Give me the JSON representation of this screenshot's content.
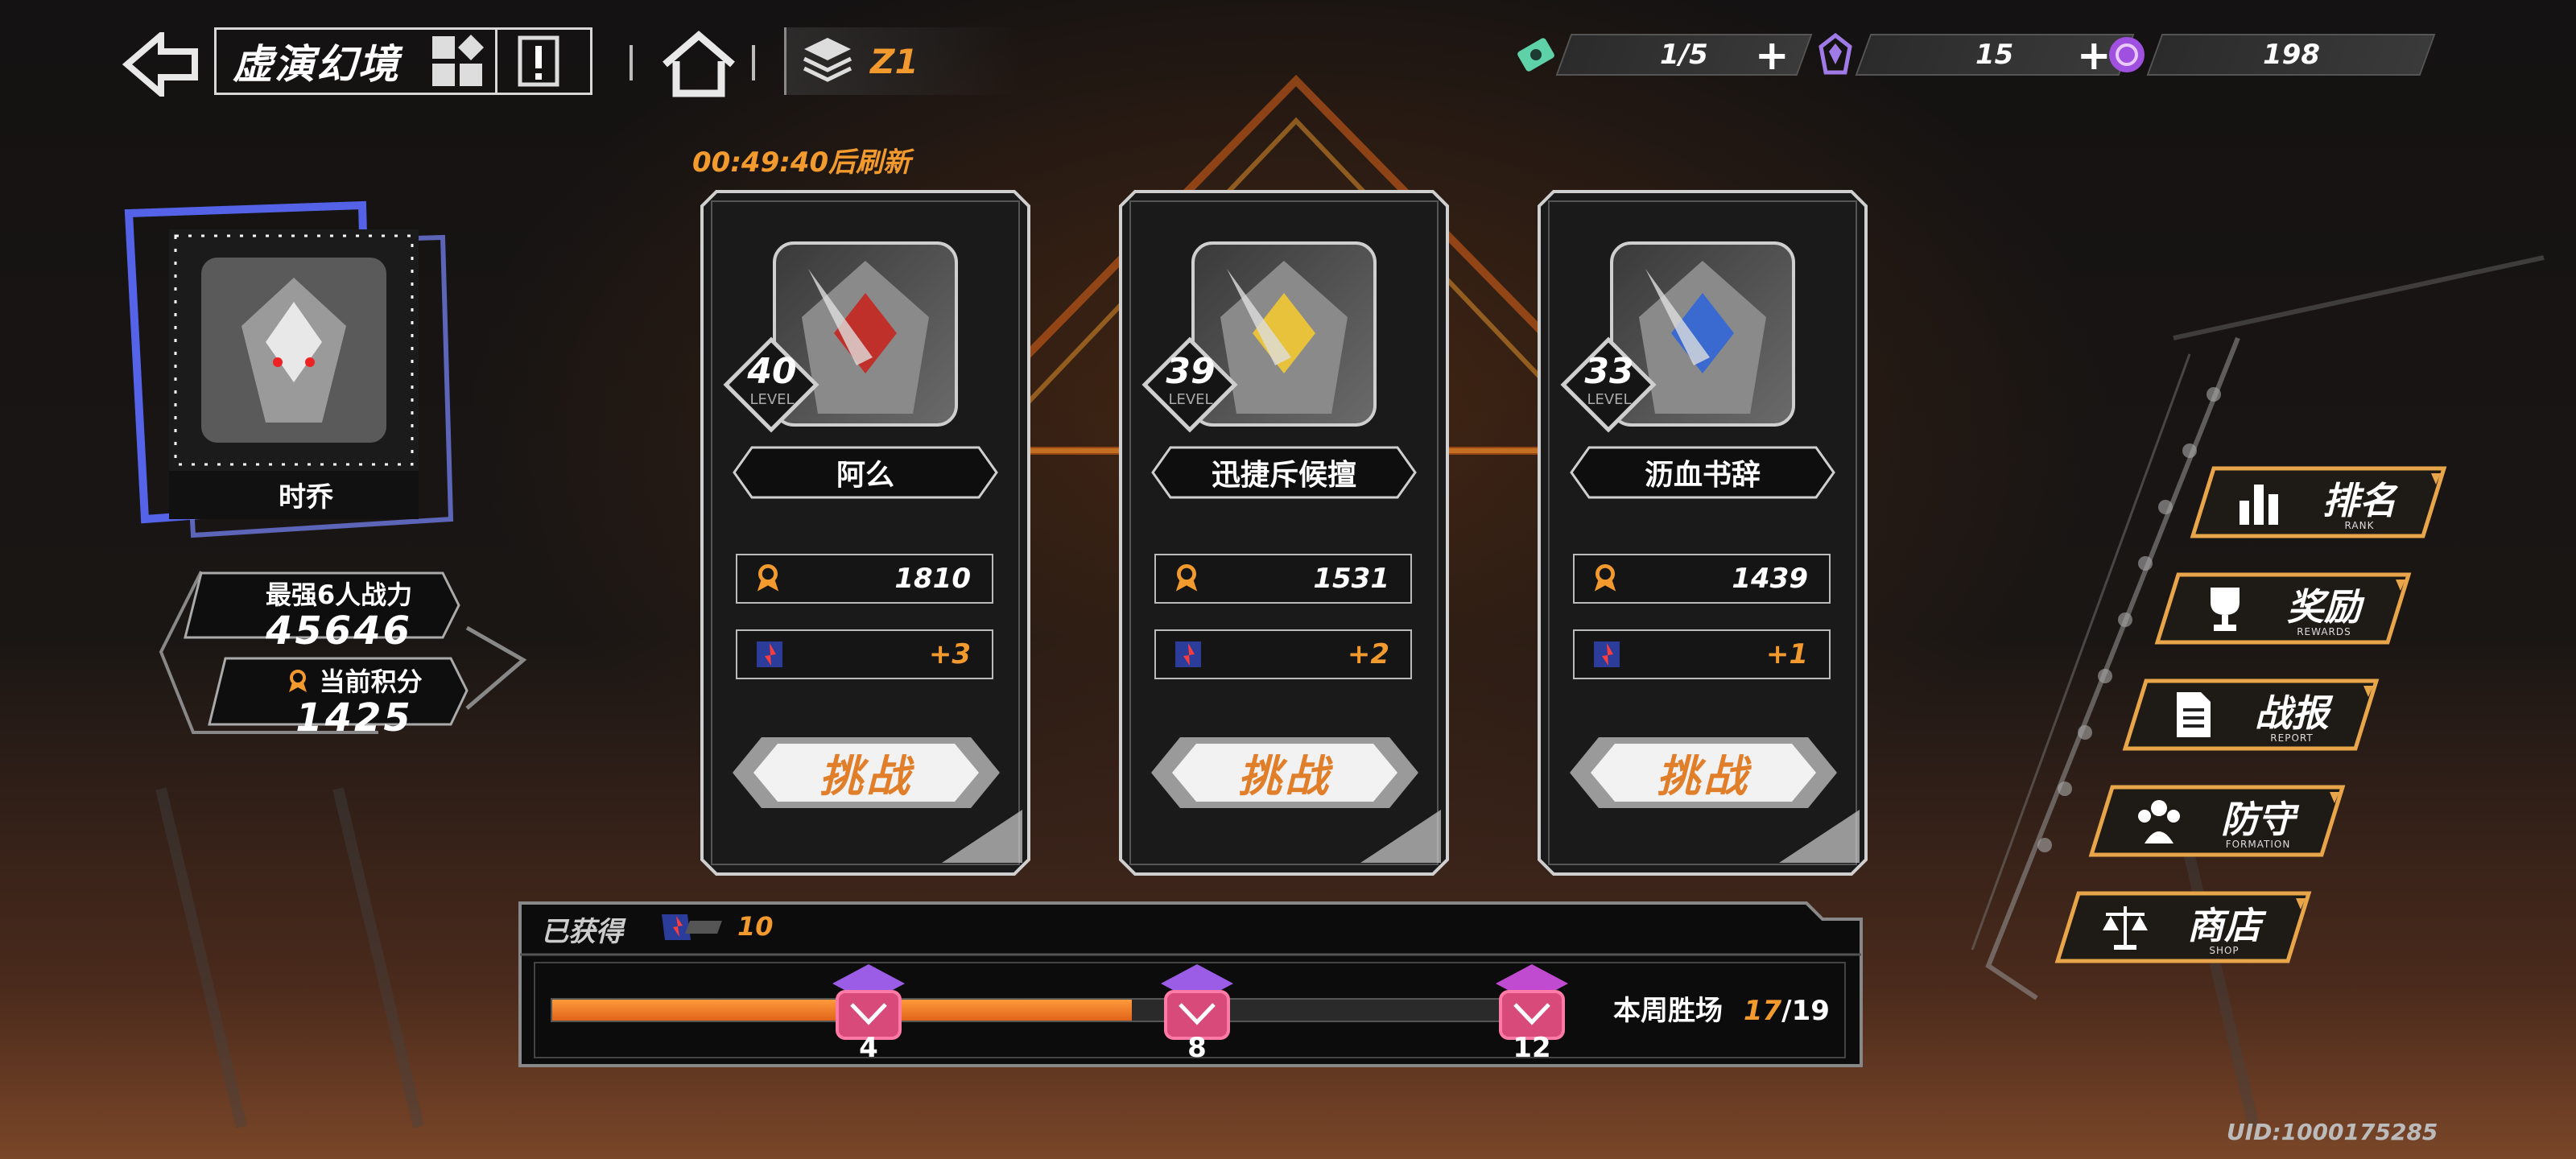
{
  "top_bar": {
    "title": "虚演幻境",
    "layer_label": "Z1",
    "resources": [
      {
        "icon": "ticket-icon",
        "value": "1/5",
        "has_plus": true,
        "color": "#5ed1a8"
      },
      {
        "icon": "crystal-icon",
        "value": "15",
        "has_plus": true,
        "color": "#a07be8"
      },
      {
        "icon": "gear-coin-icon",
        "value": "198",
        "has_plus": false,
        "color": "#a050e0"
      }
    ]
  },
  "timer": "00:49:40后刷新",
  "player": {
    "name": "时乔",
    "power_label": "最强6人战力",
    "power_value": "45646",
    "score_label": "当前积分",
    "score_value": "1425"
  },
  "opponents": [
    {
      "level": "40",
      "level_label": "LEVEL",
      "name": "阿么",
      "score": "1810",
      "bonus": "+3",
      "challenge": "挑战",
      "accent": "#c0302a"
    },
    {
      "level": "39",
      "level_label": "LEVEL",
      "name": "迅捷斥候擅",
      "score": "1531",
      "bonus": "+2",
      "challenge": "挑战",
      "accent": "#e8c23a"
    },
    {
      "level": "33",
      "level_label": "LEVEL",
      "name": "沥血书辞",
      "score": "1439",
      "bonus": "+1",
      "challenge": "挑战",
      "accent": "#3a6ad0"
    }
  ],
  "progress": {
    "title": "已获得",
    "earned": "10",
    "fill_fraction": 0.61,
    "milestones": [
      "4",
      "8",
      "12"
    ],
    "weekly_label": "本周胜场",
    "weekly_current": "17",
    "weekly_total": "/19"
  },
  "menu": [
    {
      "label": "排名",
      "sub": "RANK",
      "icon": "bar-chart-icon"
    },
    {
      "label": "奖励",
      "sub": "REWARDS",
      "icon": "trophy-icon"
    },
    {
      "label": "战报",
      "sub": "REPORT",
      "icon": "document-icon"
    },
    {
      "label": "防守",
      "sub": "FORMATION",
      "icon": "team-icon"
    },
    {
      "label": "商店",
      "sub": "SHOP",
      "icon": "scale-icon"
    }
  ],
  "uid": "UID:1000175285",
  "colors": {
    "accent": "#f29a2e",
    "neon_blue": "#5b6cff",
    "gold_border": "#e8a54a"
  }
}
